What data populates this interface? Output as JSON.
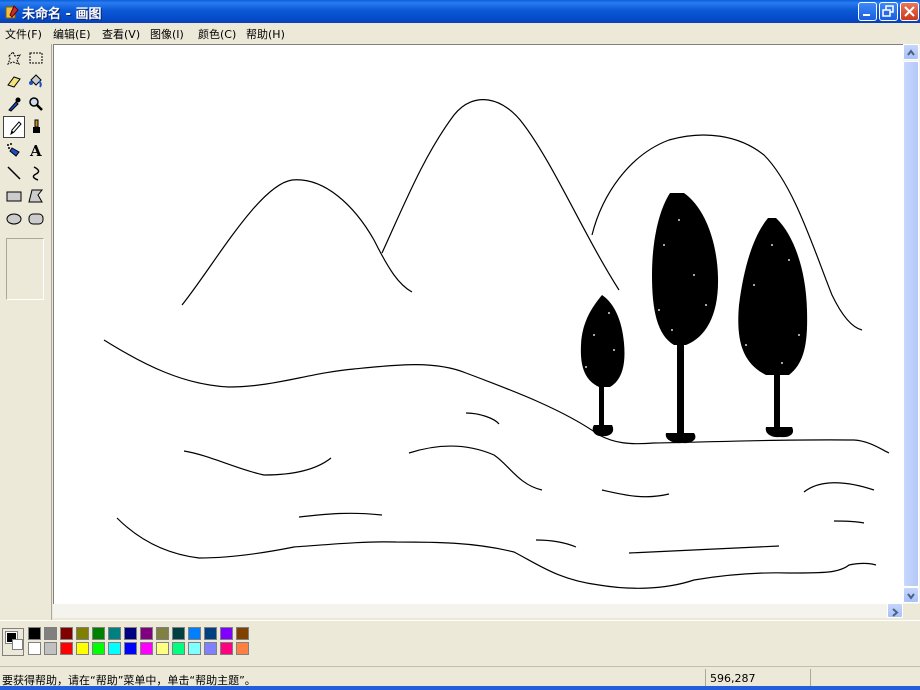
{
  "window": {
    "title": "未命名 - 画图",
    "icon": "paint-app-icon"
  },
  "menu": [
    {
      "label": "文件(F)"
    },
    {
      "label": "编辑(E)"
    },
    {
      "label": "查看(V)"
    },
    {
      "label": "图像(I)"
    },
    {
      "label": "颜色(C)"
    },
    {
      "label": "帮助(H)"
    }
  ],
  "tools": [
    {
      "name": "free-form-select-icon"
    },
    {
      "name": "rect-select-icon"
    },
    {
      "name": "eraser-icon"
    },
    {
      "name": "fill-bucket-icon"
    },
    {
      "name": "pick-color-icon"
    },
    {
      "name": "magnifier-icon"
    },
    {
      "name": "pencil-icon",
      "selected": true
    },
    {
      "name": "brush-icon"
    },
    {
      "name": "airbrush-icon"
    },
    {
      "name": "text-icon",
      "glyph": "A"
    },
    {
      "name": "line-icon"
    },
    {
      "name": "curve-icon"
    },
    {
      "name": "rectangle-icon"
    },
    {
      "name": "polygon-icon"
    },
    {
      "name": "ellipse-icon"
    },
    {
      "name": "rounded-rect-icon"
    }
  ],
  "palette": {
    "foreground": "#000000",
    "background": "#ffffff",
    "top_row": [
      "#000000",
      "#808080",
      "#800000",
      "#808000",
      "#008000",
      "#008080",
      "#000080",
      "#800080",
      "#808040",
      "#004040",
      "#0080ff",
      "#004080",
      "#8000ff",
      "#804000"
    ],
    "bottom_row": [
      "#ffffff",
      "#c0c0c0",
      "#ff0000",
      "#ffff00",
      "#00ff00",
      "#00ffff",
      "#0000ff",
      "#ff00ff",
      "#ffff80",
      "#00ff80",
      "#80ffff",
      "#8080ff",
      "#ff0080",
      "#ff8040"
    ]
  },
  "status": {
    "help_text": "要获得帮助，请在“帮助”菜单中，单击“帮助主题”。",
    "coordinates": "596,287"
  }
}
